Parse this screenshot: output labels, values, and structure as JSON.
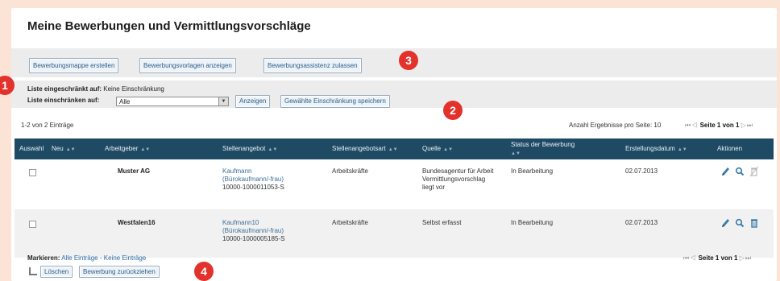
{
  "page": {
    "title": "Meine Bewerbungen und Vermittlungsvorschläge"
  },
  "toolbar": {
    "buttons": [
      "Bewerbungsmappe erstellen",
      "Bewerbungsvorlagen anzeigen",
      "Bewerbungsassistenz zulassen"
    ]
  },
  "filter": {
    "restricted_label": "Liste eingeschränkt auf:",
    "restricted_value": "Keine Einschränkung",
    "restrict_label": "Liste einschränken auf:",
    "select_value": "Alle",
    "show_button": "Anzeigen",
    "save_button": "Gewählte Einschränkung speichern"
  },
  "results": {
    "count_text": "1-2 von 2 Einträge",
    "per_page_text": "Anzahl Ergebnisse pro Seite: 10",
    "page_text": "Seite 1 von 1"
  },
  "table": {
    "headers": [
      "Auswahl",
      "Neu",
      "Arbeitgeber",
      "Stellenangebot",
      "Stellenangebotsart",
      "Quelle",
      "Status der Bewerbung",
      "Erstellungsdatum",
      "Aktionen"
    ],
    "rows": [
      {
        "employer": "Muster AG",
        "offer_title": "Kaufmann (Bürokaufmann/-frau)",
        "offer_id": "10000-1000011053-S",
        "offer_type": "Arbeitskräfte",
        "source": "Bundesagentur für Arbeit Vermittlungsvorschlag liegt vor",
        "status": "In Bearbeitung",
        "date": "02.07.2013"
      },
      {
        "employer": "Westfalen16",
        "offer_title": "Kaufmann10 (Bürokaufmann/-frau)",
        "offer_id": "10000-1000005185-S",
        "offer_type": "Arbeitskräfte",
        "source": "Selbst erfasst",
        "status": "In Bearbeitung",
        "date": "02.07.2013"
      }
    ]
  },
  "footer": {
    "mark_label": "Markieren:",
    "mark_all": "Alle Einträge",
    "separator": "-",
    "mark_none": "Keine Einträge",
    "delete_button": "Löschen",
    "withdraw_button": "Bewerbung zurückziehen",
    "page_text": "Seite 1 von 1"
  },
  "markers": [
    "1",
    "2",
    "3",
    "4"
  ],
  "colors": {
    "background": "#fbe3d6",
    "header_bar": "#1e4a64",
    "marker": "#e2322b",
    "link": "#3f6f99"
  },
  "icons": [
    "pencil-icon",
    "magnifier-icon",
    "trash-icon",
    "first-page-icon",
    "prev-page-icon",
    "next-page-icon",
    "last-page-icon"
  ]
}
